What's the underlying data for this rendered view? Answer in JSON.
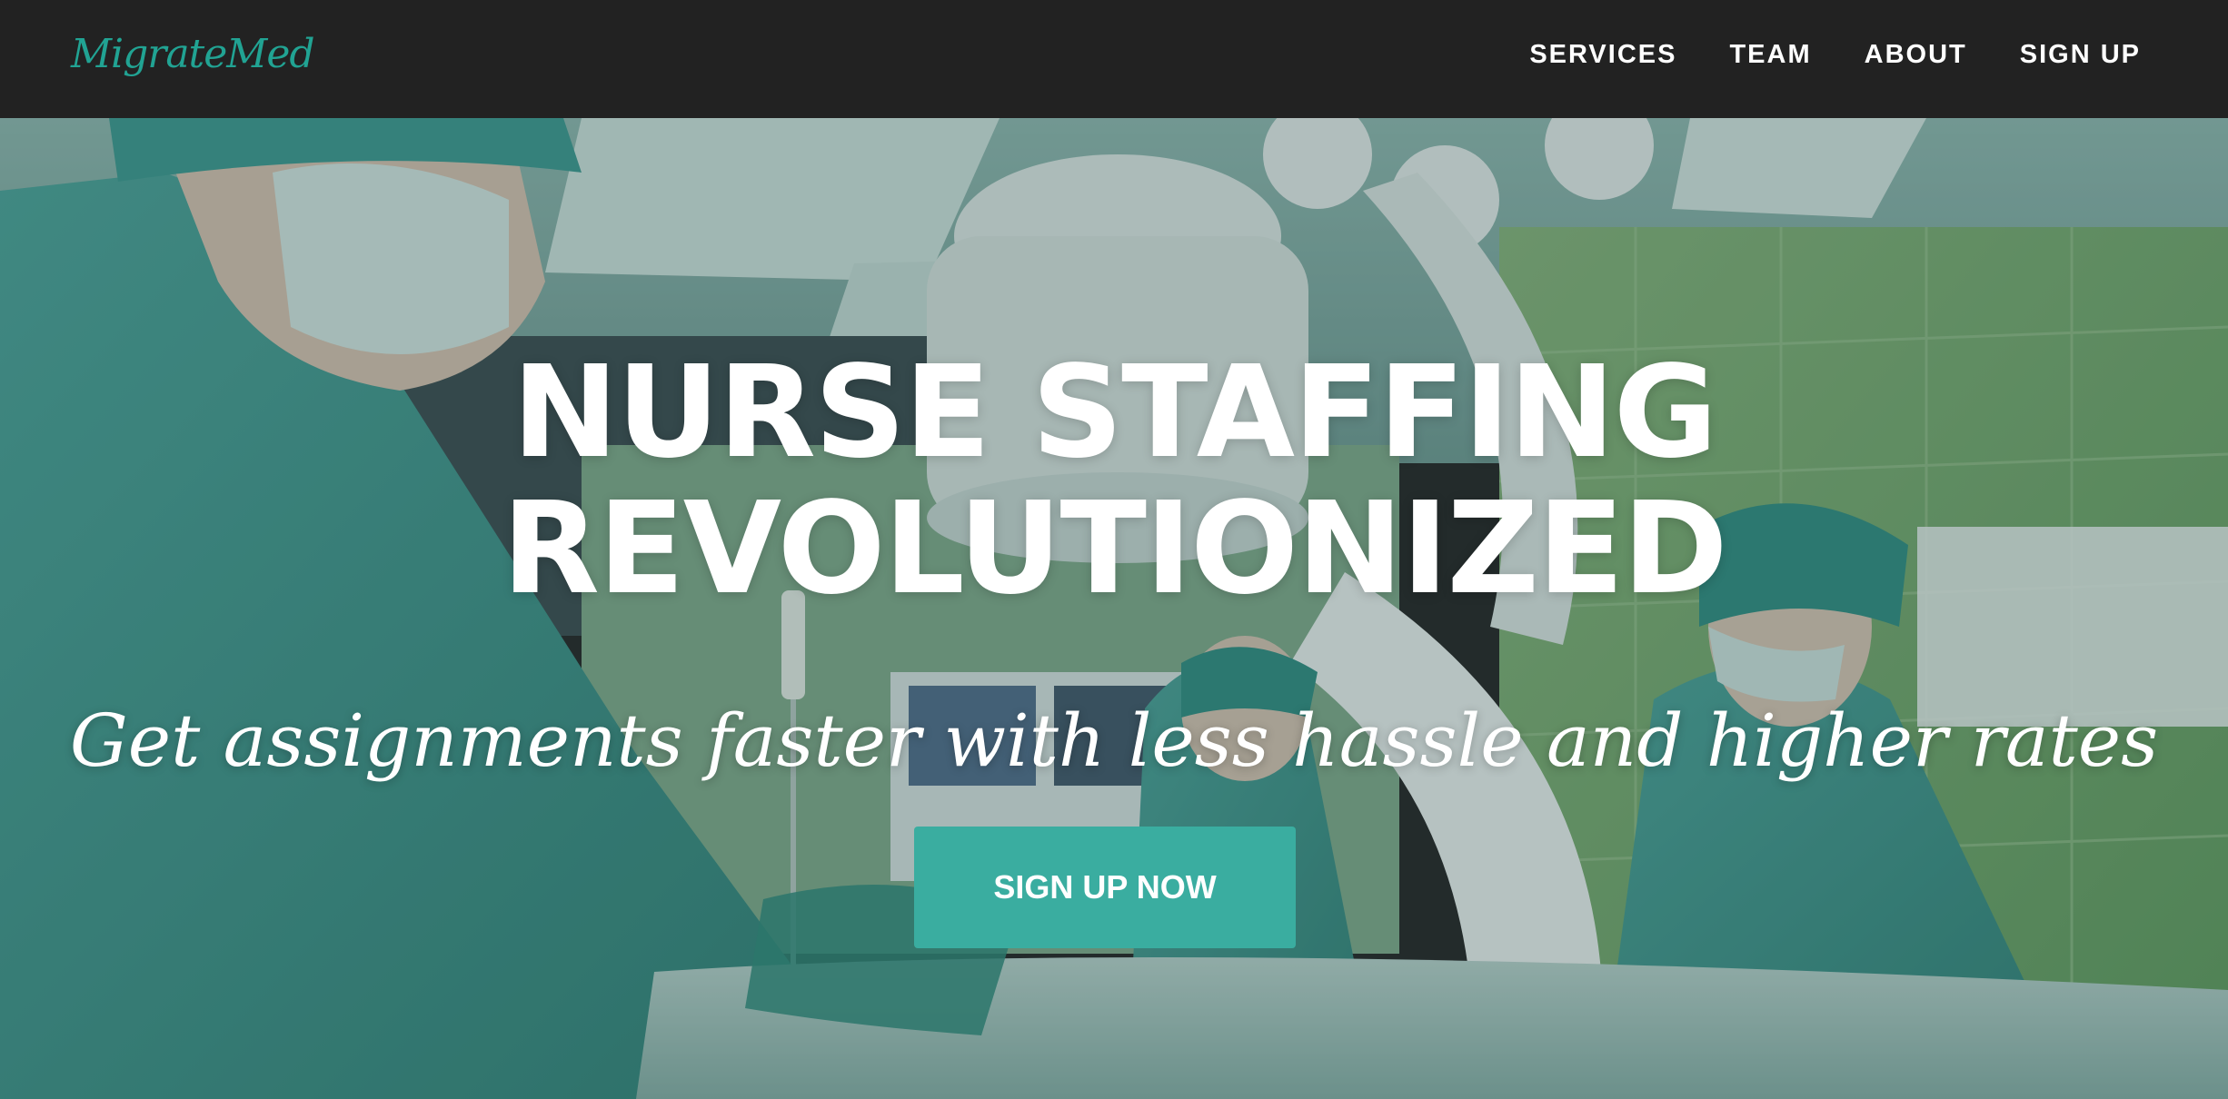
{
  "navbar": {
    "brand": "MigrateMed",
    "links": [
      {
        "label": "SERVICES"
      },
      {
        "label": "TEAM"
      },
      {
        "label": "ABOUT"
      },
      {
        "label": "SIGN UP"
      }
    ]
  },
  "hero": {
    "title_line1": "NURSE STAFFING",
    "title_line2": "REVOLUTIONIZED",
    "tagline": "Get assignments faster with less hassle and higher rates",
    "cta_label": "SIGN UP NOW",
    "background_image": "operating-room-surgeons-photo"
  },
  "colors": {
    "navbar_bg": "#222222",
    "brand": "#21a393",
    "accent": "#3aada0",
    "text": "#ffffff"
  }
}
